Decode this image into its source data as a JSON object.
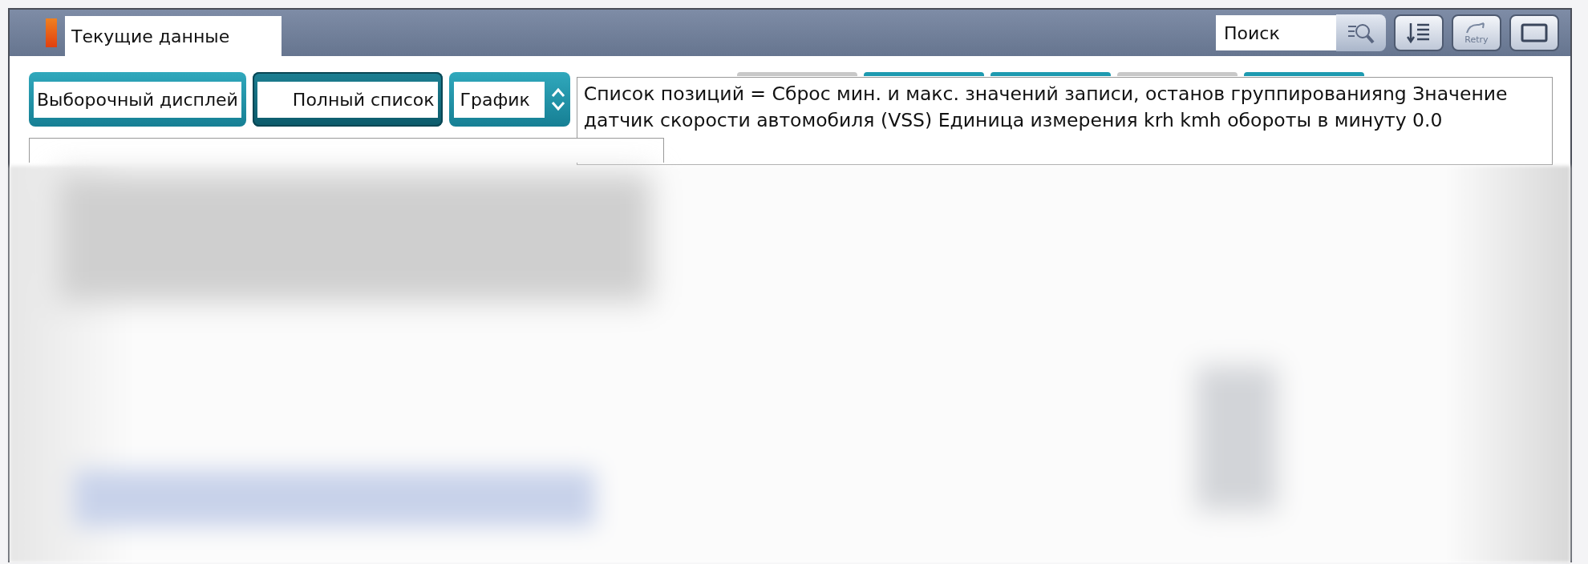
{
  "window": {
    "title": "Текущие данные"
  },
  "search": {
    "placeholder": "Поиск"
  },
  "toolbar_buttons": [
    {
      "kind": "search"
    },
    {
      "kind": "sort"
    },
    {
      "kind": "retry",
      "label": "Retry"
    },
    {
      "kind": "window"
    }
  ],
  "view_buttons": [
    {
      "label": "Выборочный дисплей",
      "selected": false
    },
    {
      "label": "Полный список",
      "selected": true
    }
  ],
  "view_select": {
    "value": "График"
  },
  "tab_strips": [
    {
      "color": "#c8c8c8"
    },
    {
      "color": "#1e9ab0"
    },
    {
      "color": "#1e9ab0"
    },
    {
      "color": "#c8c8c8"
    },
    {
      "color": "#1e9ab0"
    }
  ],
  "info_text": "Список позиций = Сброс мин. и макс. значений записи, останов группированияng Значение датчик скорости автомобиля (VSS) Единица измерения krh kmh обороты в минуту 0.0"
}
